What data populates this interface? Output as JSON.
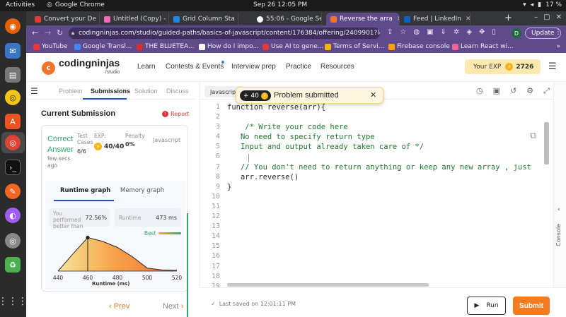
{
  "os": {
    "activities": "Activities",
    "app_name": "Google Chrome",
    "clock": "Sep 26  12:05 PM",
    "battery": "17 %"
  },
  "browser": {
    "tabs": [
      {
        "title": "Convert your De",
        "color": "#e53935"
      },
      {
        "title": "Untitled (Copy) -",
        "color": "#f06ab7"
      },
      {
        "title": "Grid Column Sta",
        "color": "#1e88e5"
      },
      {
        "title": "55:06 - Google Se",
        "color": "#ffffff"
      },
      {
        "title": "Reverse the arra",
        "color": "#f1742a"
      },
      {
        "title": "Feed | LinkedIn",
        "color": "#0a66c2"
      }
    ],
    "url": "codingninjas.com/studio/guided-paths/basics-of-javascript/content/176384/offering/2409901?lef...",
    "profile_initial": "D",
    "update_label": "Update",
    "bookmarks": [
      {
        "label": "YouTube",
        "color": "#e53935"
      },
      {
        "label": "Google Transl...",
        "color": "#4285f4"
      },
      {
        "label": "THE BLUETEA...",
        "color": "#d32f2f"
      },
      {
        "label": "How do I impo...",
        "color": "#ffffff"
      },
      {
        "label": "Use AI to gene...",
        "color": "#e53935"
      },
      {
        "label": "Terms of Servi...",
        "color": "#f4b400"
      },
      {
        "label": "Firebase console",
        "color": "#ffa000"
      },
      {
        "label": "Learn React wi...",
        "color": "#f06292"
      }
    ]
  },
  "site": {
    "logo": "codingninjas",
    "logo_sub": "/studio",
    "nav": [
      "Learn",
      "Contests & Events",
      "Interview prep",
      "Practice",
      "Resources"
    ],
    "exp_label": "Your EXP",
    "exp_value": "2726"
  },
  "left_panel": {
    "tabs": [
      "Problem",
      "Submissions",
      "Solution",
      "Discuss"
    ],
    "active_tab": "Submissions",
    "title": "Current Submission",
    "report": "Report",
    "status": "Correct Answer",
    "time_ago": "few secs ago",
    "test_cases_label": "Test Cases",
    "test_cases_value": "6/6",
    "exp_label": "EXP:",
    "exp_value": "40/40",
    "penalty_label": "Penalty",
    "penalty_value": "0%",
    "language": "Javascript",
    "graph_tabs": [
      "Runtime graph",
      "Memory graph"
    ],
    "perf_label": "You performed better than",
    "perf_value": "72.56%",
    "runtime_label": "Runtime",
    "runtime_value": "473 ms",
    "prev": "Prev",
    "next": "Next"
  },
  "chart_data": {
    "type": "area",
    "xlabel": "Runtime (ms)",
    "x_ticks": [
      440,
      460,
      480,
      500,
      520
    ],
    "xlim": [
      440,
      520
    ],
    "ylim": [
      0,
      1
    ],
    "x": [
      440,
      450,
      460,
      470,
      480,
      490,
      500,
      510,
      520
    ],
    "y": [
      0.0,
      0.45,
      0.88,
      0.78,
      0.62,
      0.38,
      0.08,
      0.03,
      0.02
    ],
    "marker_x": 460,
    "legend": "Best",
    "grid": false
  },
  "editor": {
    "language_tab": "Javascript",
    "lines": [
      "function reverse(arr){",
      "",
      "    /* Write your code here",
      "   No need to specify return type",
      "   Input and output already taken care of */",
      "",
      "   // You don't need to return anything or keep any new array , just",
      "   arr.reverse()",
      "}",
      "",
      "",
      "",
      "",
      "",
      "",
      "",
      "",
      "",
      ""
    ],
    "comment_lines": [
      2,
      3,
      4,
      6
    ],
    "console_label": "Console"
  },
  "toast": {
    "badge": "+ 40",
    "message": "Problem submitted"
  },
  "bottom": {
    "saved": "Last saved on 12:01:11 PM",
    "run": "Run",
    "submit": "Submit"
  }
}
